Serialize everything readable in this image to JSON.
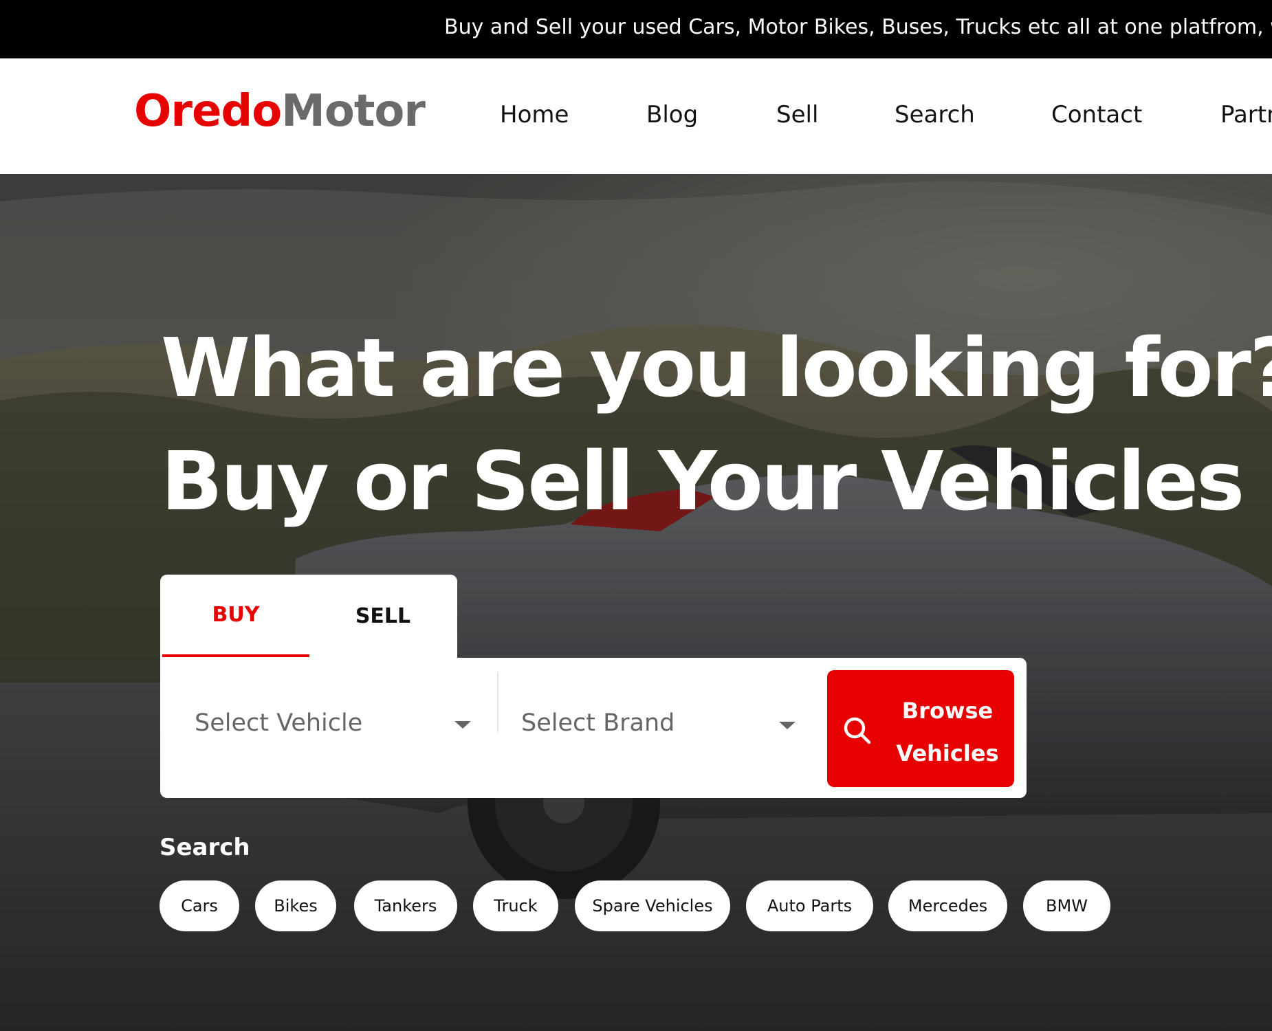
{
  "announcement": {
    "text": "Buy and Sell your used Cars, Motor Bikes, Buses, Trucks etc all at one platfrom, with"
  },
  "logo": {
    "part1": "Oredo",
    "part2": "Motor"
  },
  "nav": {
    "items": [
      "Home",
      "Blog",
      "Sell",
      "Search",
      "Contact",
      "Partn"
    ]
  },
  "hero": {
    "headline_line1": "What are you looking for?",
    "headline_line2": "Buy or Sell Your Vehicles"
  },
  "tabs": {
    "buy": "BUY",
    "sell": "SELL",
    "active": "buy"
  },
  "search_form": {
    "vehicle_placeholder": "Select Vehicle",
    "brand_placeholder": "Select Brand",
    "browse_line1": "Browse",
    "browse_line2": "Vehicles"
  },
  "quick_search": {
    "label": "Search",
    "chips": [
      "Cars",
      "Bikes",
      "Tankers",
      "Truck",
      "Spare Vehicles",
      "Auto Parts",
      "Mercedes",
      "BMW"
    ]
  },
  "colors": {
    "brand_red": "#e60000",
    "logo_gray": "#6a6a6a",
    "announcement_bg": "#000000"
  },
  "icons": {
    "browse": "search-icon",
    "select": "caret-down-icon"
  }
}
